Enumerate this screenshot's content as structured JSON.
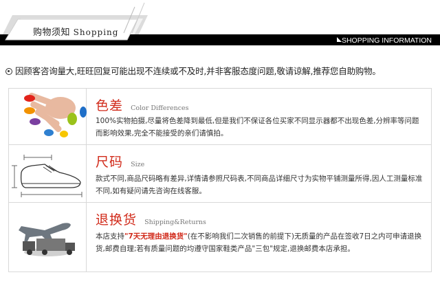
{
  "header": {
    "tab_title_cn": "购物须知",
    "tab_title_en": "Shopping",
    "info_label": "SHOPPING INFORMATION"
  },
  "notice": {
    "text": "因顾客咨询量大,旺旺回复可能出现不连续或不及时,并非客服态度问题,敬请谅解,推荐您自助购物。"
  },
  "sections": [
    {
      "title_cn": "色差",
      "title_en": "Color Differences",
      "image_icon": "painted-fingers-icon",
      "desc": "100%实物拍摄,尽量将色差降到最低,但是我们不保证各位买家不同显示器都不出现色差,分辨率等问题而影响效果,完全不能接受的亲们请慎拍。"
    },
    {
      "title_cn": "尺码",
      "title_en": "Size",
      "image_icon": "shoe-measure-icon",
      "desc": "款式不同,商品尺码略有差异,详情请参照尺码表,不同商品详细尺寸为实物平铺测量所得,因人工测量标准不同,如有疑问请先咨询在线客服。"
    },
    {
      "title_cn": "退换货",
      "title_en": "Shipping&Returns",
      "image_icon": "airplane-truck-icon",
      "desc_prefix": "本店支持",
      "desc_highlight": "\"7天无理由退换货\"",
      "desc_suffix": "(在不影响我们二次销售的前提下)无质量的产品在签收7日之内可申请退换货,邮费自理;若有质量问题的均遵守国家鞋类产品\"三包\"规定,退换邮费本店承担。"
    }
  ],
  "colors": {
    "accent_red": "#d12a1a",
    "banner_black": "#000000"
  }
}
